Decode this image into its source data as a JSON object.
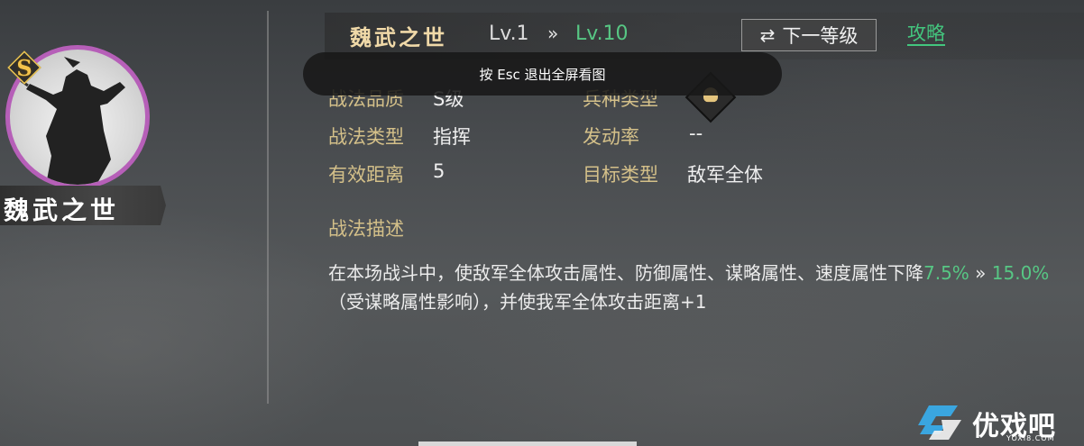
{
  "card": {
    "rank": "S",
    "name": "魏武之世"
  },
  "header": {
    "title": "魏武之世",
    "level_from": "Lv.1",
    "level_arrow": "»",
    "level_to": "Lv.10",
    "next_level_button": "下一等级",
    "guide_link": "攻略"
  },
  "toast": {
    "text": "按 Esc 退出全屏看图"
  },
  "attributes": [
    {
      "label": "战法品质",
      "value": "S级"
    },
    {
      "label": "兵种类型",
      "value": "",
      "icon": "troop-type-icon"
    },
    {
      "label": "战法类型",
      "value": "指挥"
    },
    {
      "label": "发动率",
      "value": "--"
    },
    {
      "label": "有效距离",
      "value": "5"
    },
    {
      "label": "目标类型",
      "value": "敌军全体"
    }
  ],
  "description": {
    "label": "战法描述",
    "text_part1": "在本场战斗中，使敌军全体攻击属性、防御属性、谋略属性、速度属性下降",
    "value_from": "7.5%",
    "arrow": " » ",
    "value_to": "15.0%",
    "text_part2": "（受谋略属性影响），并使我军全体攻击距离+1"
  },
  "watermark": {
    "site_name": "优戏吧",
    "url": "YOXI8.COM"
  },
  "colors": {
    "accent_green": "#57c784",
    "label_gold": "#d4c089",
    "rank_purple": "#b65fb8"
  }
}
